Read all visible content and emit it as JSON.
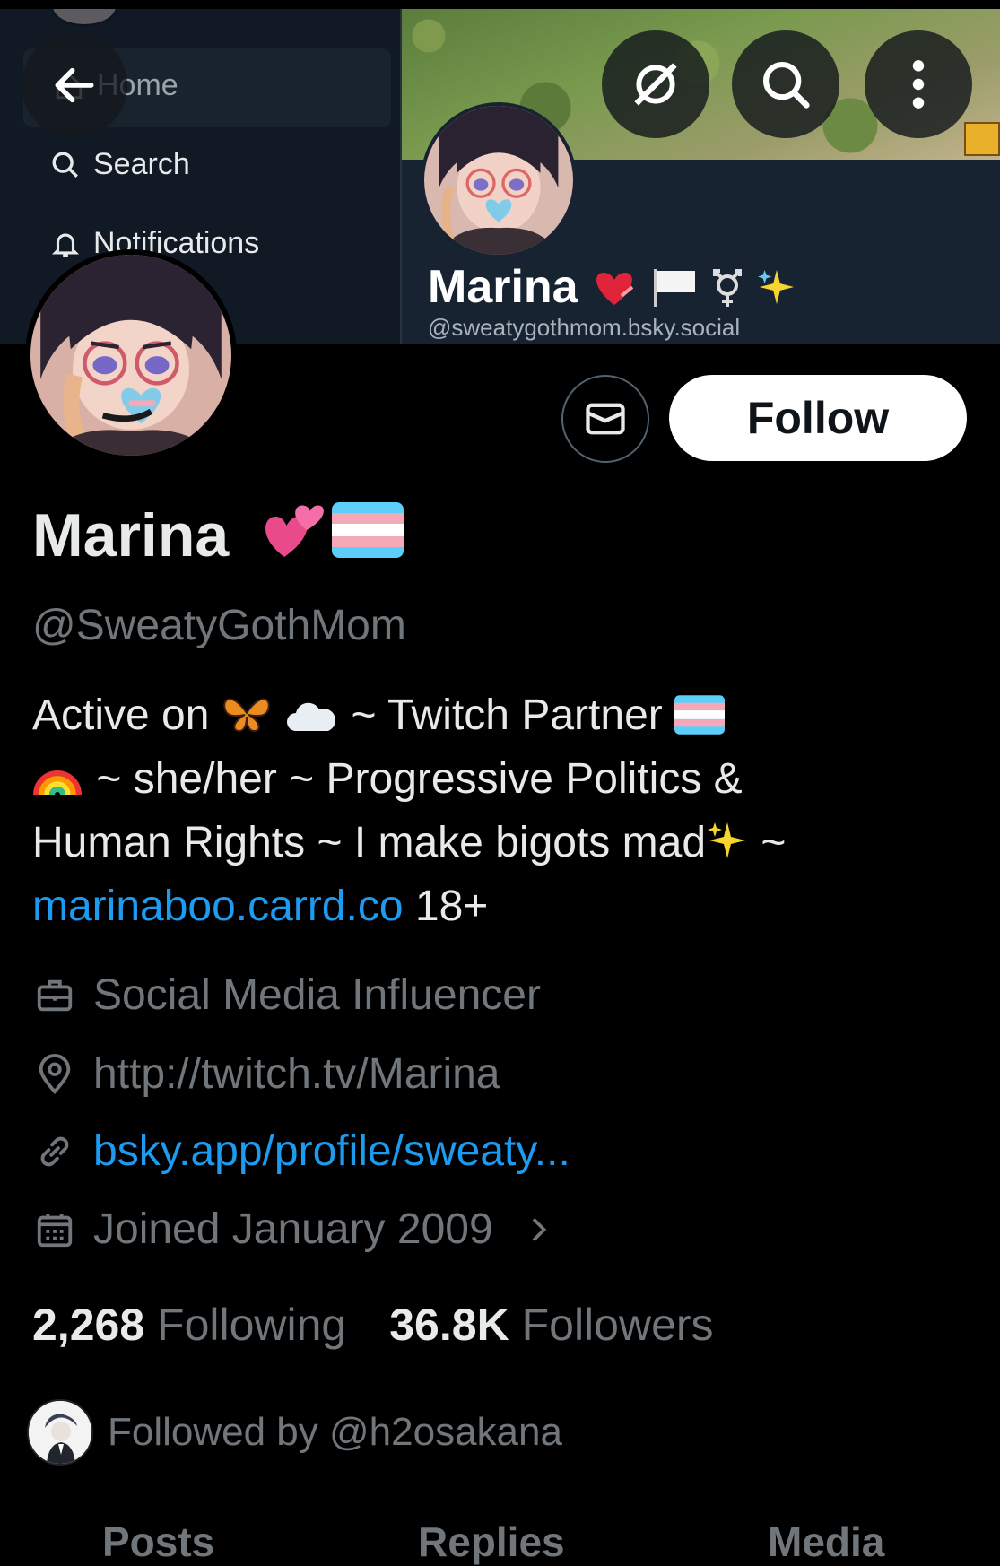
{
  "banner": {
    "nav_home": "Home",
    "nav_search": "Search",
    "nav_notifications": "Notifications",
    "inner_name": "Marina",
    "inner_handle": "@sweatygothmom.bsky.social"
  },
  "profile": {
    "display_name": "Marina",
    "handle": "@SweatyGothMom",
    "dm_icon": "envelope-icon",
    "follow_label": "Follow",
    "bio": {
      "line1_a": "Active on",
      "line1_b": "~ Twitch Partner",
      "line2": "~ she/her ~ Progressive Politics &",
      "line3_a": "Human Rights ~ I make bigots mad",
      "line3_b": "~",
      "link": "marinaboo.carrd.co",
      "line4_rest": "18+"
    },
    "work": "Social Media Influencer",
    "location": "http://twitch.tv/Marina",
    "website": "bsky.app/profile/sweaty...",
    "joined": "Joined January 2009",
    "following_count": "2,268",
    "following_label": "Following",
    "followers_count": "36.8K",
    "followers_label": "Followers",
    "followed_by": "Followed by @h2osakana"
  },
  "tabs": [
    "Posts",
    "Replies",
    "Media"
  ],
  "colors": {
    "accent": "#1d9bf0",
    "muted": "#71767b",
    "text": "#e7e9ea"
  }
}
